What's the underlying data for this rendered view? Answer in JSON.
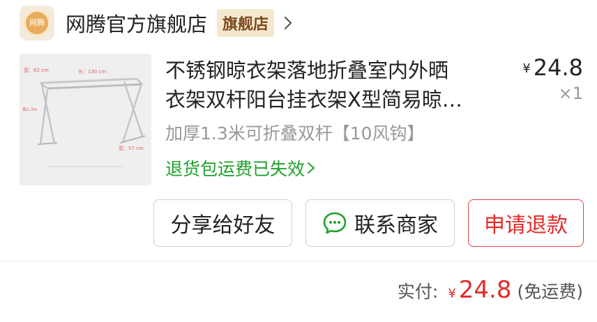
{
  "store": {
    "logo_text": "网腾",
    "name": "网腾官方旗舰店",
    "badge": "旗舰店"
  },
  "product": {
    "title_line1": "不锈钢晾衣架落地折叠室内外晒",
    "title_line2": "衣架双杆阳台挂衣架X型简易晾…",
    "currency": "¥",
    "price": "24.8",
    "quantity": "×1",
    "spec": "加厚1.3米可折叠双杆【10风钩】",
    "return_note": "退货包运费已失效",
    "image": {
      "label_width": "宽：62 cm",
      "label_length": "长：130 cm",
      "label_height": "高1.3m",
      "label_base": "宽：57 cm"
    }
  },
  "actions": {
    "share": "分享给好友",
    "contact": "联系商家",
    "refund": "申请退款"
  },
  "summary": {
    "label": "实付:",
    "currency": "¥",
    "amount": "24.8",
    "note": "(免运费)"
  },
  "colors": {
    "accent_red": "#e32a2a",
    "green": "#1fa02c",
    "badge_bg": "#f6e8cf"
  }
}
